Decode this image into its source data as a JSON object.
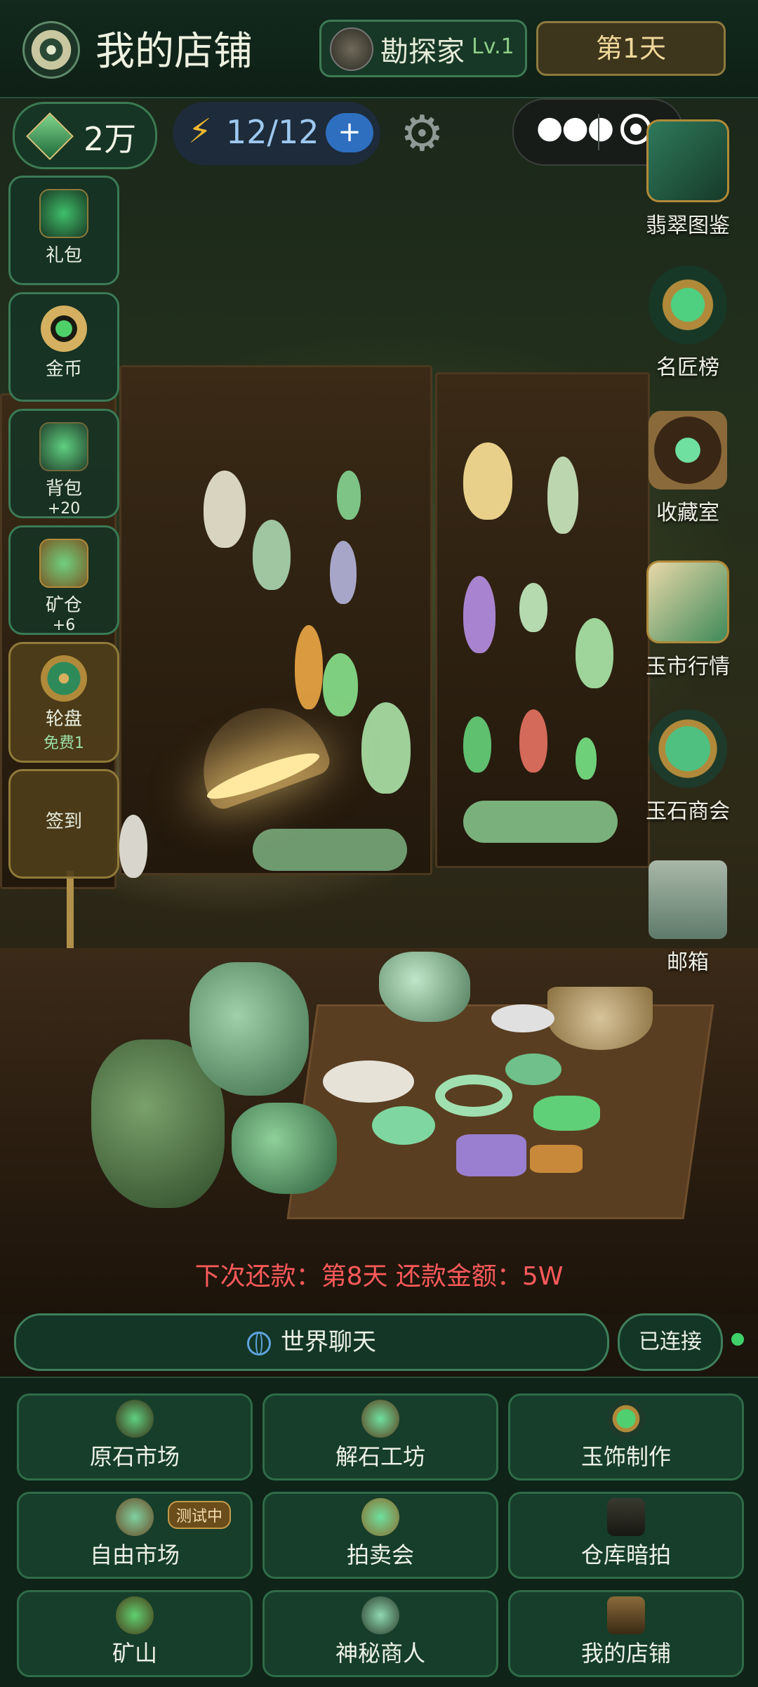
{
  "header": {
    "title": "我的店铺",
    "rank_name": "勘探家",
    "rank_level": "Lv.1",
    "day": "第1天"
  },
  "stats": {
    "money": "2万",
    "energy": "12/12",
    "energy_plus": "+"
  },
  "left_menu": [
    {
      "label": "礼包",
      "sub": ""
    },
    {
      "label": "金币",
      "sub": ""
    },
    {
      "label": "背包",
      "sub": "+20"
    },
    {
      "label": "矿仓",
      "sub": "+6"
    },
    {
      "label": "轮盘",
      "sub": "免费1"
    },
    {
      "label": "签到",
      "sub": ""
    }
  ],
  "right_menu": [
    {
      "label": "翡翠图鉴"
    },
    {
      "label": "名匠榜"
    },
    {
      "label": "收藏室"
    },
    {
      "label": "玉市行情"
    },
    {
      "label": "玉石商会"
    },
    {
      "label": "邮箱"
    }
  ],
  "debt_notice": "下次还款：第8天 还款金额：5W",
  "chat": {
    "label": "世界聊天",
    "status": "已连接"
  },
  "grid": [
    {
      "label": "原石市场",
      "badge": ""
    },
    {
      "label": "解石工坊",
      "badge": ""
    },
    {
      "label": "玉饰制作",
      "badge": ""
    },
    {
      "label": "自由市场",
      "badge": "测试中"
    },
    {
      "label": "拍卖会",
      "badge": ""
    },
    {
      "label": "仓库暗拍",
      "badge": ""
    },
    {
      "label": "矿山",
      "badge": ""
    },
    {
      "label": "神秘商人",
      "badge": ""
    },
    {
      "label": "我的店铺",
      "badge": ""
    }
  ],
  "colors": {
    "accent_green": "#3b7a55",
    "debt_red": "#ff5a5a",
    "online_dot": "#3fd06a"
  }
}
